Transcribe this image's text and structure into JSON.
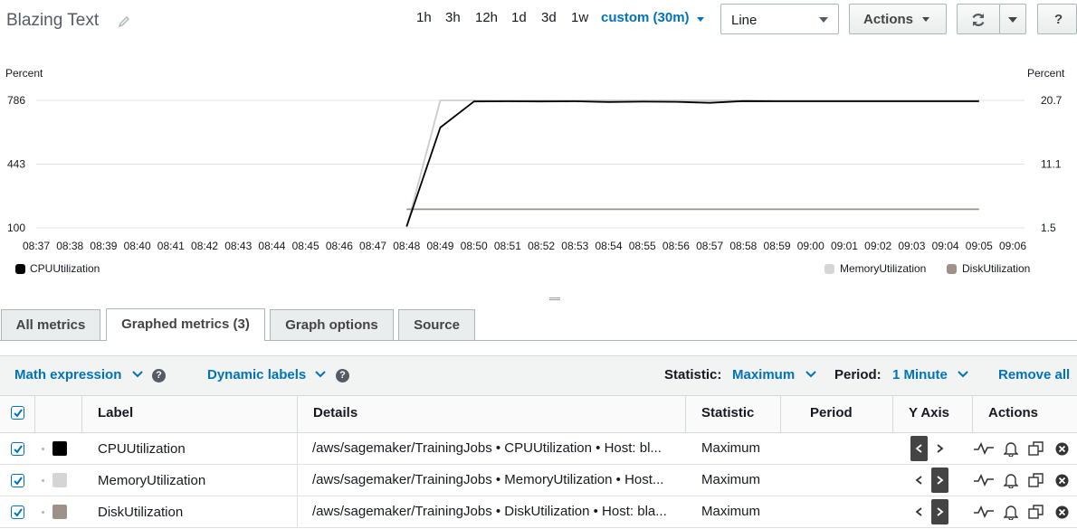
{
  "header": {
    "title": "Blazing Text",
    "ranges": [
      "1h",
      "3h",
      "12h",
      "1d",
      "3d",
      "1w"
    ],
    "custom_range": "custom (30m)",
    "graph_type": "Line",
    "actions_label": "Actions",
    "help_label": "?"
  },
  "chart_data": {
    "type": "line",
    "left_axis": {
      "unit": "Percent",
      "ticks": [
        "786",
        "443",
        "100"
      ],
      "range": [
        100,
        786
      ]
    },
    "right_axis": {
      "unit": "Percent",
      "ticks": [
        "20.7",
        "11.1",
        "1.5"
      ],
      "range": [
        1.5,
        20.7
      ]
    },
    "x": [
      "08:37",
      "08:38",
      "08:39",
      "08:40",
      "08:41",
      "08:42",
      "08:43",
      "08:44",
      "08:45",
      "08:46",
      "08:47",
      "08:48",
      "08:49",
      "08:50",
      "08:51",
      "08:52",
      "08:53",
      "08:54",
      "08:55",
      "08:56",
      "08:57",
      "08:58",
      "08:59",
      "09:00",
      "09:01",
      "09:02",
      "09:03",
      "09:04",
      "09:05",
      "09:06"
    ],
    "series": [
      {
        "name": "CPUUtilization",
        "axis": "left",
        "color": "#000000",
        "x": [
          "08:48",
          "08:49",
          "08:50",
          "08:51",
          "08:52",
          "08:53",
          "08:54",
          "08:55",
          "08:56",
          "08:57",
          "08:58",
          "08:59",
          "09:00",
          "09:01",
          "09:02",
          "09:03",
          "09:04",
          "09:05"
        ],
        "values": [
          108,
          640,
          780,
          781,
          780,
          781,
          777,
          779,
          778,
          773,
          782,
          781,
          781,
          781,
          781,
          781,
          781,
          781
        ]
      },
      {
        "name": "MemoryUtilization",
        "axis": "right",
        "color": "#cccccc",
        "x": [
          "08:48",
          "08:49",
          "08:50",
          "08:51",
          "08:52",
          "08:53",
          "08:54",
          "08:55",
          "08:56",
          "08:57",
          "08:58",
          "08:59",
          "09:00",
          "09:01",
          "09:02",
          "09:03",
          "09:04",
          "09:05"
        ],
        "values": [
          1.6,
          20.7,
          20.7,
          20.7,
          20.7,
          20.7,
          20.7,
          20.7,
          20.7,
          20.7,
          20.7,
          20.7,
          20.7,
          20.7,
          20.7,
          20.7,
          20.7,
          20.7
        ]
      },
      {
        "name": "DiskUtilization",
        "axis": "right",
        "color": "#9e918a",
        "x": [
          "08:48",
          "08:49",
          "08:50",
          "08:51",
          "08:52",
          "08:53",
          "08:54",
          "08:55",
          "08:56",
          "08:57",
          "08:58",
          "08:59",
          "09:00",
          "09:01",
          "09:02",
          "09:03",
          "09:04",
          "09:05"
        ],
        "values": [
          4.3,
          4.3,
          4.3,
          4.3,
          4.3,
          4.3,
          4.3,
          4.3,
          4.3,
          4.3,
          4.3,
          4.3,
          4.3,
          4.3,
          4.3,
          4.3,
          4.3,
          4.3
        ]
      }
    ],
    "legend_left": [
      "CPUUtilization"
    ],
    "legend_right": [
      "MemoryUtilization",
      "DiskUtilization"
    ],
    "grid": true
  },
  "tabs": [
    "All metrics",
    "Graphed metrics (3)",
    "Graph options",
    "Source"
  ],
  "toolbar": {
    "math_expression": "Math expression",
    "dynamic_labels": "Dynamic labels",
    "statistic_label": "Statistic:",
    "statistic_value": "Maximum",
    "period_label": "Period:",
    "period_value": "1 Minute",
    "remove_all": "Remove all"
  },
  "table": {
    "headers": {
      "label": "Label",
      "details": "Details",
      "statistic": "Statistic",
      "period": "Period",
      "yaxis": "Y Axis",
      "actions": "Actions"
    },
    "rows": [
      {
        "label": "CPUUtilization",
        "details": "/aws/sagemaker/TrainingJobs • CPUUtilization • Host: bl...",
        "statistic": "Maximum",
        "period": "",
        "color": "#000000",
        "yaxis": "left"
      },
      {
        "label": "MemoryUtilization",
        "details": "/aws/sagemaker/TrainingJobs • MemoryUtilization • Host...",
        "statistic": "Maximum",
        "period": "",
        "color": "#d5d5d5",
        "yaxis": "right"
      },
      {
        "label": "DiskUtilization",
        "details": "/aws/sagemaker/TrainingJobs • DiskUtilization • Host: bla...",
        "statistic": "Maximum",
        "period": "",
        "color": "#9e918a",
        "yaxis": "right"
      }
    ]
  }
}
